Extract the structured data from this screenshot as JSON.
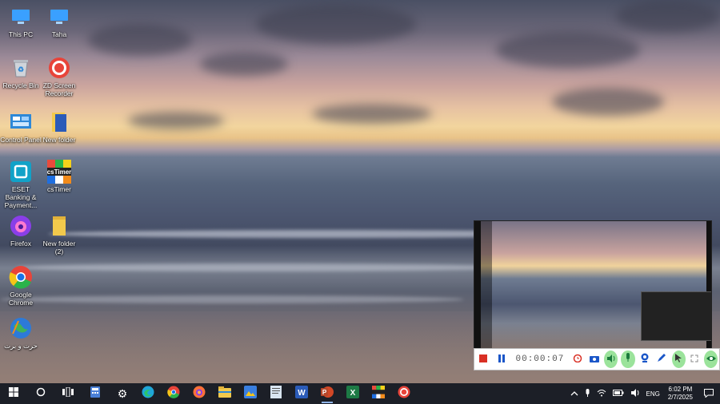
{
  "desktop": {
    "icons": [
      {
        "label": "This PC",
        "icon": "computer-icon",
        "color": "#3aa0ff"
      },
      {
        "label": "Taha",
        "icon": "computer-icon",
        "color": "#3aa0ff"
      },
      {
        "label": "Recycle Bin",
        "icon": "recycle-bin-icon",
        "color": "#d0d4da"
      },
      {
        "label": "ZD Screen Recorder",
        "icon": "record-icon",
        "color": "#e8443a"
      },
      {
        "label": "Control Panel",
        "icon": "control-panel-icon",
        "color": "#2d88d8"
      },
      {
        "label": "New folder",
        "icon": "folder-icon",
        "color": "#f2c94c"
      },
      {
        "label": "ESET Banking & Payment...",
        "icon": "eset-icon",
        "color": "#11a2c8"
      },
      {
        "label": "csTimer",
        "icon": "cstimer-icon",
        "color": "#e94b3c"
      },
      {
        "label": "Firefox",
        "icon": "firefox-icon",
        "color": "#8a3ee8"
      },
      {
        "label": "New folder (2)",
        "icon": "folder-icon",
        "color": "#f2c94c"
      },
      {
        "label": "Google Chrome",
        "icon": "chrome-icon",
        "color": "#1a73e8"
      },
      {
        "label": "حرت و برت",
        "icon": "globe-icon",
        "color": "#2d7ad8"
      }
    ]
  },
  "recorder": {
    "timer": "00:00:07",
    "controls": [
      {
        "name": "stop-record-button",
        "icon": "stop-icon"
      },
      {
        "name": "pause-record-button",
        "icon": "pause-icon"
      },
      {
        "name": "alarm-button",
        "icon": "alarm-icon"
      },
      {
        "name": "camera-button",
        "icon": "camera-icon"
      },
      {
        "name": "speaker-button",
        "icon": "speaker-icon"
      },
      {
        "name": "microphone-button",
        "icon": "microphone-icon"
      },
      {
        "name": "webcam-button",
        "icon": "webcam-icon"
      },
      {
        "name": "draw-button",
        "icon": "pen-icon"
      },
      {
        "name": "cursor-button",
        "icon": "cursor-icon"
      },
      {
        "name": "fullscreen-button",
        "icon": "expand-icon"
      },
      {
        "name": "preview-toggle-button",
        "icon": "eye-icon"
      }
    ]
  },
  "taskbar": {
    "apps": [
      {
        "name": "start-button",
        "icon": "windows-icon",
        "color": "#ffffff"
      },
      {
        "name": "search-button",
        "icon": "search-circle-icon",
        "color": "#ffffff"
      },
      {
        "name": "task-view-button",
        "icon": "task-view-icon",
        "color": "#ffffff"
      },
      {
        "name": "calculator-app",
        "icon": "calculator-icon",
        "color": "#4a7fd6"
      },
      {
        "name": "settings-app",
        "icon": "gear-icon",
        "color": "#ffffff"
      },
      {
        "name": "edge-app",
        "icon": "edge-icon",
        "color": "#1fa6d9"
      },
      {
        "name": "chrome-app",
        "icon": "chrome-icon",
        "color": "#1a73e8"
      },
      {
        "name": "firefox-app",
        "icon": "firefox-icon",
        "color": "#ff7139"
      },
      {
        "name": "file-explorer-app",
        "icon": "folder-icon",
        "color": "#f2c94c"
      },
      {
        "name": "photos-app",
        "icon": "photos-icon",
        "color": "#3a7fe0"
      },
      {
        "name": "notepad-app",
        "icon": "notepad-icon",
        "color": "#d8e4f0"
      },
      {
        "name": "word-app",
        "icon": "word-icon",
        "color": "#2b5bb8"
      },
      {
        "name": "powerpoint-app",
        "icon": "powerpoint-icon",
        "color": "#d24726"
      },
      {
        "name": "excel-app",
        "icon": "excel-icon",
        "color": "#1d7a45"
      },
      {
        "name": "cstimer-app",
        "icon": "cstimer-icon",
        "color": "#e94b3c"
      },
      {
        "name": "zd-recorder-app",
        "icon": "record-icon",
        "color": "#e8443a"
      }
    ],
    "tray": {
      "language": "ENG",
      "time": "6:02 PM",
      "date": "2/7/2025"
    }
  }
}
